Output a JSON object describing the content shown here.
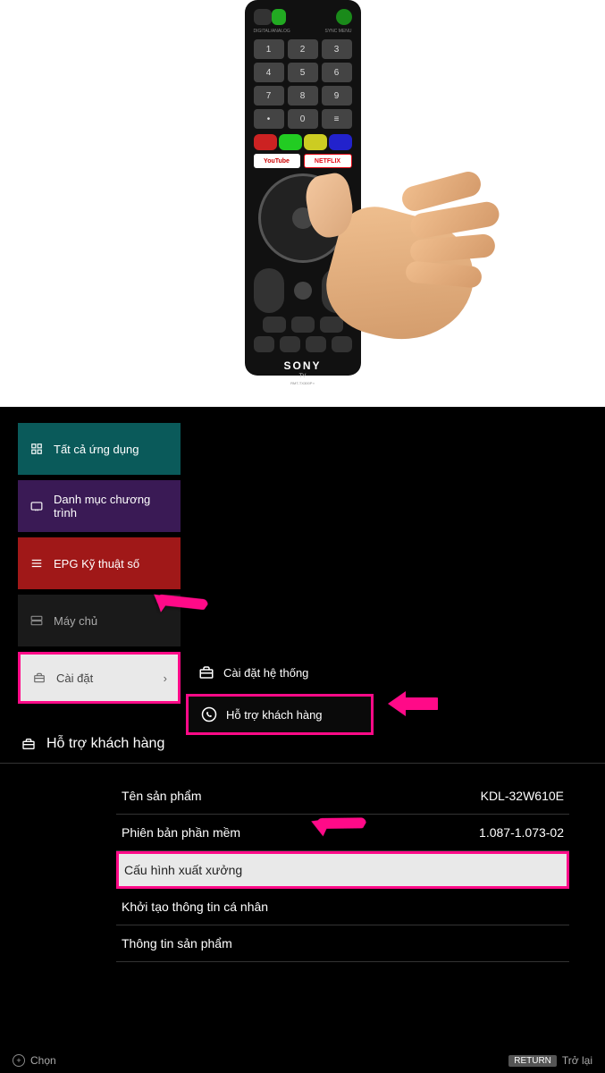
{
  "remote": {
    "brand": "SONY",
    "tv_label": "TV",
    "youtube": "YouTube",
    "netflix": "NETFLIX"
  },
  "menu": {
    "apps": "Tất cả ứng dụng",
    "category": "Danh mục chương trình",
    "epg": "EPG Kỹ thuật số",
    "server": "Máy chủ",
    "settings": "Cài đặt"
  },
  "submenu": {
    "system": "Cài đặt hệ thống",
    "support": "Hỗ trợ khách hàng"
  },
  "panel": {
    "title": "Hỗ trợ khách hàng",
    "rows": {
      "product_name_label": "Tên sản phẩm",
      "product_name_value": "KDL-32W610E",
      "software_label": "Phiên bản phần mềm",
      "software_value": "1.087-1.073-02",
      "factory": "Cấu hình xuất xưởng",
      "reset_personal": "Khởi tạo thông tin cá nhân",
      "product_info": "Thông tin sản phẩm"
    }
  },
  "footer": {
    "select": "Chọn",
    "return_label": "RETURN",
    "back": "Trở lại"
  },
  "colors": {
    "highlight": "#ff0a88"
  }
}
